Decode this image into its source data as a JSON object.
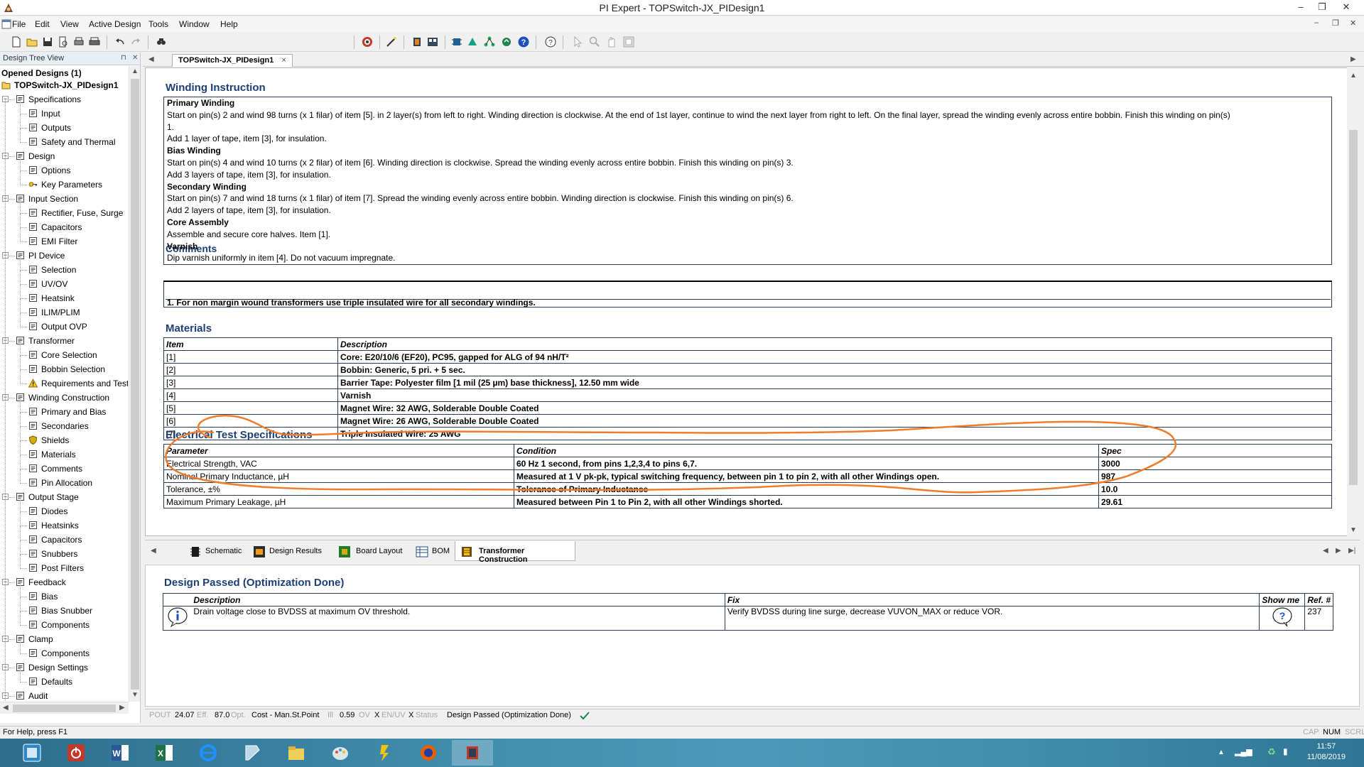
{
  "window": {
    "title": "PI Expert - TOPSwitch-JX_PIDesign1",
    "controls": {
      "minimize": "–",
      "restore": "❐",
      "close": "✕"
    }
  },
  "menu": [
    "File",
    "Edit",
    "View",
    "Active Design",
    "Tools",
    "Window",
    "Help"
  ],
  "toolbar": {
    "icons": [
      "new-file",
      "open-file",
      "save",
      "print-preview",
      "print",
      "print-all",
      "undo",
      "redo",
      "find",
      "optimize",
      "design-wizard",
      "tool-a",
      "tool-b",
      "tool-c",
      "tool-d",
      "tool-e",
      "tool-f",
      "help",
      "context-help",
      "pointer",
      "zoom",
      "pan",
      "fit"
    ]
  },
  "tree": {
    "header": "Design Tree View",
    "opened": "Opened Designs (1)",
    "design": "TOPSwitch-JX_PIDesign1",
    "nodes": [
      {
        "label": "Specifications",
        "icon": "spec-icon",
        "level": 1
      },
      {
        "label": "Input",
        "icon": "input-icon",
        "level": 2
      },
      {
        "label": "Outputs",
        "icon": "output-icon",
        "level": 2
      },
      {
        "label": "Safety and Thermal",
        "icon": "thermal-icon",
        "level": 2
      },
      {
        "label": "Design",
        "icon": "design-icon",
        "level": 1
      },
      {
        "label": "Options",
        "icon": "options-icon",
        "level": 2
      },
      {
        "label": "Key Parameters",
        "icon": "key-icon",
        "level": 2
      },
      {
        "label": "Input Section",
        "icon": "input-section-icon",
        "level": 1
      },
      {
        "label": "Rectifier, Fuse, Surge",
        "icon": "rectifier-icon",
        "level": 2
      },
      {
        "label": "Capacitors",
        "icon": "capacitor-icon",
        "level": 2
      },
      {
        "label": "EMI Filter",
        "icon": "emi-icon",
        "level": 2
      },
      {
        "label": "PI Device",
        "icon": "chip-icon",
        "level": 1
      },
      {
        "label": "Selection",
        "icon": "selection-icon",
        "level": 2
      },
      {
        "label": "UV/OV",
        "icon": "uvov-icon",
        "level": 2
      },
      {
        "label": "Heatsink",
        "icon": "heatsink-icon",
        "level": 2
      },
      {
        "label": "ILIM/PLIM",
        "icon": "ilim-icon",
        "level": 2
      },
      {
        "label": "Output OVP",
        "icon": "ovp-icon",
        "level": 2
      },
      {
        "label": "Transformer",
        "icon": "transformer-icon",
        "level": 1
      },
      {
        "label": "Core Selection",
        "icon": "core-icon",
        "level": 2
      },
      {
        "label": "Bobbin Selection",
        "icon": "bobbin-icon",
        "level": 2
      },
      {
        "label": "Requirements and Test",
        "icon": "warning-icon",
        "level": 2
      },
      {
        "label": "Winding Construction",
        "icon": "winding-icon",
        "level": 1
      },
      {
        "label": "Primary and Bias",
        "icon": "primary-icon",
        "level": 2
      },
      {
        "label": "Secondaries",
        "icon": "secondary-icon",
        "level": 2
      },
      {
        "label": "Shields",
        "icon": "shield-icon",
        "level": 2
      },
      {
        "label": "Materials",
        "icon": "materials-icon",
        "level": 2
      },
      {
        "label": "Comments",
        "icon": "comments-icon",
        "level": 2
      },
      {
        "label": "Pin Allocation",
        "icon": "pin-icon",
        "level": 2
      },
      {
        "label": "Output Stage",
        "icon": "output-stage-icon",
        "level": 1
      },
      {
        "label": "Diodes",
        "icon": "diode-icon",
        "level": 2
      },
      {
        "label": "Heatsinks",
        "icon": "heatsink-icon",
        "level": 2
      },
      {
        "label": "Capacitors",
        "icon": "capacitor-icon",
        "level": 2
      },
      {
        "label": "Snubbers",
        "icon": "snubber-icon",
        "level": 2
      },
      {
        "label": "Post Filters",
        "icon": "filter-icon",
        "level": 2
      },
      {
        "label": "Feedback",
        "icon": "feedback-icon",
        "level": 1
      },
      {
        "label": "Bias",
        "icon": "bias-icon",
        "level": 2
      },
      {
        "label": "Bias Snubber",
        "icon": "snubber-icon",
        "level": 2
      },
      {
        "label": "Components",
        "icon": "components-icon",
        "level": 2
      },
      {
        "label": "Clamp",
        "icon": "clamp-icon",
        "level": 1
      },
      {
        "label": "Components",
        "icon": "components-icon",
        "level": 2
      },
      {
        "label": "Design Settings",
        "icon": "settings-icon",
        "level": 1
      },
      {
        "label": "Defaults",
        "icon": "defaults-icon",
        "level": 2
      },
      {
        "label": "Audit",
        "icon": "audit-icon",
        "level": 1
      }
    ]
  },
  "doc_tab": {
    "label": "TOPSwitch-JX_PIDesign1",
    "close": "×"
  },
  "winding": {
    "title": "Winding Instruction",
    "lines": [
      {
        "text": "Primary Winding",
        "bold": true
      },
      {
        "text": "Start on pin(s) 2 and wind 98 turns (x 1 filar) of item [5]. in 2 layer(s) from left to right. Winding direction is clockwise. At the end of 1st layer, continue to wind the next layer from right to left. On the final layer, spread the winding evenly across entire bobbin. Finish this winding on pin(s)",
        "bold": false
      },
      {
        "text": "1.",
        "bold": false
      },
      {
        "text": "Add 1 layer of tape, item [3], for insulation.",
        "bold": false
      },
      {
        "text": "Bias Winding",
        "bold": true
      },
      {
        "text": "Start on pin(s) 4 and wind 10 turns (x 2 filar) of item [6]. Winding direction is clockwise. Spread the winding evenly across entire bobbin. Finish this winding on pin(s) 3.",
        "bold": false
      },
      {
        "text": "Add 3 layers of tape, item [3], for insulation.",
        "bold": false
      },
      {
        "text": "Secondary Winding",
        "bold": true
      },
      {
        "text": "Start on pin(s) 7 and wind 18 turns (x 1 filar) of item [7]. Spread the winding evenly across entire bobbin. Winding direction is clockwise. Finish this winding on pin(s) 6.",
        "bold": false
      },
      {
        "text": "Add 2 layers of tape, item [3], for insulation.",
        "bold": false
      },
      {
        "text": "Core Assembly",
        "bold": true
      },
      {
        "text": "Assemble and secure core halves. Item [1].",
        "bold": false
      },
      {
        "text": "Varnish",
        "bold": true
      },
      {
        "text": "Dip varnish uniformly in item [4]. Do not vacuum impregnate.",
        "bold": false
      }
    ]
  },
  "comments": {
    "title": "Comments",
    "text": "1. For non margin wound transformers use triple insulated wire for all secondary windings."
  },
  "materials": {
    "title": "Materials",
    "headers": [
      "Item",
      "Description"
    ],
    "rows": [
      [
        "[1]",
        "Core: E20/10/6 (EF20), PC95, gapped for ALG of 94 nH/T²"
      ],
      [
        "[2]",
        "Bobbin: Generic, 5 pri. + 5 sec."
      ],
      [
        "[3]",
        "Barrier Tape: Polyester film [1 mil (25 µm) base thickness], 12.50 mm wide"
      ],
      [
        "[4]",
        "Varnish"
      ],
      [
        "[5]",
        "Magnet Wire: 32 AWG, Solderable Double Coated"
      ],
      [
        "[6]",
        "Magnet Wire: 26 AWG, Solderable Double Coated"
      ],
      [
        "[7]",
        "Triple Insulated Wire: 25 AWG"
      ]
    ]
  },
  "electrical": {
    "title": "Electrical Test Specifications",
    "headers": [
      "Parameter",
      "Condition",
      "Spec"
    ],
    "rows": [
      [
        "Electrical Strength, VAC",
        "60 Hz 1 second, from pins 1,2,3,4 to pins 6,7.",
        "3000"
      ],
      [
        "Nominal Primary Inductance, µH",
        "Measured at 1 V pk-pk, typical switching frequency, between pin 1 to pin 2, with all other Windings open.",
        "987"
      ],
      [
        "Tolerance, ±%",
        "Tolerance of Primary Inductance",
        "10.0"
      ],
      [
        "Maximum Primary Leakage, µH",
        "Measured between Pin 1 to Pin 2, with all other Windings shorted.",
        "29.61"
      ]
    ],
    "annotation_color": "#ef7d2b"
  },
  "view_tabs": [
    {
      "label": "Schematic",
      "icon": "schematic-icon"
    },
    {
      "label": "Design Results",
      "icon": "design-results-icon"
    },
    {
      "label": "Board Layout",
      "icon": "board-layout-icon"
    },
    {
      "label": "BOM",
      "icon": "bom-icon"
    },
    {
      "label": "Transformer Construction",
      "icon": "transformer-construction-icon"
    }
  ],
  "messages": {
    "title": "Design Passed (Optimization Done)",
    "headers": [
      "Description",
      "Fix",
      "Show me",
      "Ref. #"
    ],
    "rows": [
      {
        "icon": "info-icon",
        "description": "Drain voltage close to BVDSS at maximum OV threshold.",
        "fix": "Verify BVDSS during line surge, decrease VUVON_MAX or reduce VOR.",
        "showme": "?",
        "ref": "237"
      }
    ]
  },
  "status_strip": {
    "pout_label": "POUT",
    "pout": "24.07",
    "eff_label": "Eff.",
    "eff": "87.0",
    "opt_label": "Opt.",
    "cost": "Cost - Man.St.Point",
    "ill_label": "Ill",
    "ill": "0.59",
    "ov_label": "OV",
    "x1": "X",
    "enuv_label": "EN/UV",
    "x2": "X",
    "status_label": "Status",
    "status": "Design Passed (Optimization Done)"
  },
  "app_status": {
    "help": "For Help, press F1",
    "cap": "CAP",
    "num": "NUM",
    "scrl": "SCRL"
  },
  "taskbar": {
    "apps": [
      "start-icon",
      "power-icon",
      "word-icon",
      "excel-icon",
      "ie-icon",
      "files-icon",
      "explorer-icon",
      "paint-icon",
      "flash-icon",
      "firefox-icon",
      "pi-expert-icon"
    ],
    "time": "11:57",
    "date": "11/08/2019"
  },
  "colors": {
    "accent": "#1c3f76",
    "border": "#2a3a5a",
    "annotation": "#ef7d2b"
  }
}
